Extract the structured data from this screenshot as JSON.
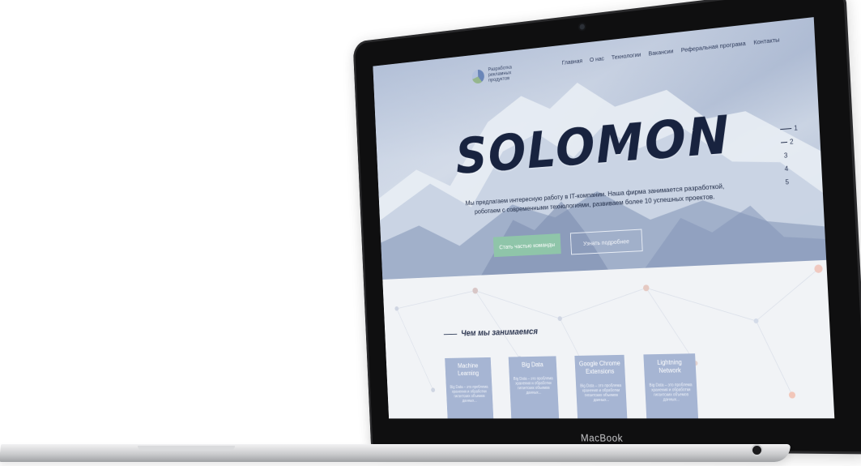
{
  "device": {
    "brand_label": "MacBook"
  },
  "site": {
    "logo": {
      "text": "Разработка рекламных продуктов"
    },
    "nav": [
      {
        "label": "Главная"
      },
      {
        "label": "О нас"
      },
      {
        "label": "Технологии"
      },
      {
        "label": "Вакансии"
      },
      {
        "label": "Реферальная програма"
      },
      {
        "label": "Контакты"
      }
    ],
    "hero": {
      "title": "SOLOMON",
      "subtitle": "Мы предлагаем интересную работу в IT-компании. Наша фирма занимается разработкой, роботаем с современными технологиями, развиваем более 10 успешных проектов.",
      "primary_button": "Стать частью команды",
      "secondary_button": "Узнать подробнее"
    },
    "slide_nav": [
      "1",
      "2",
      "3",
      "4",
      "5"
    ],
    "services": {
      "title": "Чем мы занимаемся",
      "cards": [
        {
          "title": "Machine Learning",
          "text": "Big Data – это проблема хранения и обработки гигантских объемов данных..."
        },
        {
          "title": "Big Data",
          "text": "Big Data – это проблема хранения и обработки гигантских объемов данных..."
        },
        {
          "title": "Google Chrome Extensions",
          "text": "Big Data – это проблема хранения и обработки гигантских объемов данных..."
        },
        {
          "title": "Lightning Network",
          "text": "Big Data – это проблема хранения и обработки гигантских объемов данных..."
        }
      ]
    }
  },
  "colors": {
    "accent_green": "#8fc5a9",
    "card_blue": "#a6b5d3",
    "title_dark": "#18233f"
  }
}
